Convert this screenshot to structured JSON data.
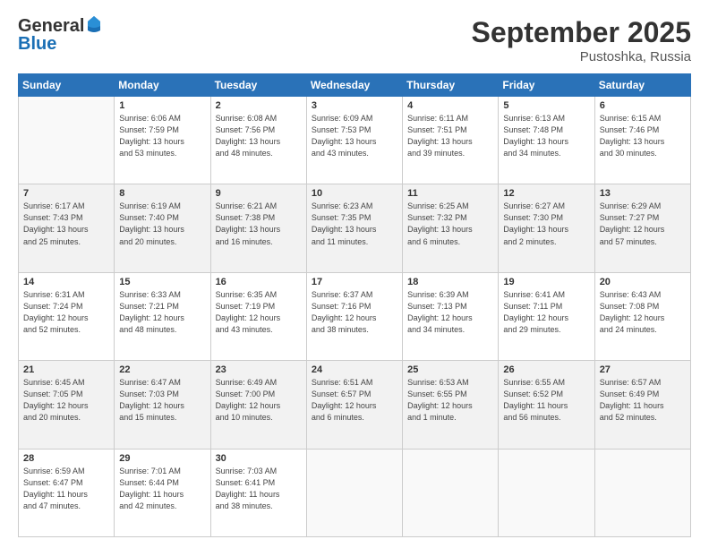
{
  "header": {
    "logo_general": "General",
    "logo_blue": "Blue",
    "month": "September 2025",
    "location": "Pustoshka, Russia"
  },
  "days_of_week": [
    "Sunday",
    "Monday",
    "Tuesday",
    "Wednesday",
    "Thursday",
    "Friday",
    "Saturday"
  ],
  "weeks": [
    [
      {
        "num": "",
        "info": ""
      },
      {
        "num": "1",
        "info": "Sunrise: 6:06 AM\nSunset: 7:59 PM\nDaylight: 13 hours\nand 53 minutes."
      },
      {
        "num": "2",
        "info": "Sunrise: 6:08 AM\nSunset: 7:56 PM\nDaylight: 13 hours\nand 48 minutes."
      },
      {
        "num": "3",
        "info": "Sunrise: 6:09 AM\nSunset: 7:53 PM\nDaylight: 13 hours\nand 43 minutes."
      },
      {
        "num": "4",
        "info": "Sunrise: 6:11 AM\nSunset: 7:51 PM\nDaylight: 13 hours\nand 39 minutes."
      },
      {
        "num": "5",
        "info": "Sunrise: 6:13 AM\nSunset: 7:48 PM\nDaylight: 13 hours\nand 34 minutes."
      },
      {
        "num": "6",
        "info": "Sunrise: 6:15 AM\nSunset: 7:46 PM\nDaylight: 13 hours\nand 30 minutes."
      }
    ],
    [
      {
        "num": "7",
        "info": "Sunrise: 6:17 AM\nSunset: 7:43 PM\nDaylight: 13 hours\nand 25 minutes."
      },
      {
        "num": "8",
        "info": "Sunrise: 6:19 AM\nSunset: 7:40 PM\nDaylight: 13 hours\nand 20 minutes."
      },
      {
        "num": "9",
        "info": "Sunrise: 6:21 AM\nSunset: 7:38 PM\nDaylight: 13 hours\nand 16 minutes."
      },
      {
        "num": "10",
        "info": "Sunrise: 6:23 AM\nSunset: 7:35 PM\nDaylight: 13 hours\nand 11 minutes."
      },
      {
        "num": "11",
        "info": "Sunrise: 6:25 AM\nSunset: 7:32 PM\nDaylight: 13 hours\nand 6 minutes."
      },
      {
        "num": "12",
        "info": "Sunrise: 6:27 AM\nSunset: 7:30 PM\nDaylight: 13 hours\nand 2 minutes."
      },
      {
        "num": "13",
        "info": "Sunrise: 6:29 AM\nSunset: 7:27 PM\nDaylight: 12 hours\nand 57 minutes."
      }
    ],
    [
      {
        "num": "14",
        "info": "Sunrise: 6:31 AM\nSunset: 7:24 PM\nDaylight: 12 hours\nand 52 minutes."
      },
      {
        "num": "15",
        "info": "Sunrise: 6:33 AM\nSunset: 7:21 PM\nDaylight: 12 hours\nand 48 minutes."
      },
      {
        "num": "16",
        "info": "Sunrise: 6:35 AM\nSunset: 7:19 PM\nDaylight: 12 hours\nand 43 minutes."
      },
      {
        "num": "17",
        "info": "Sunrise: 6:37 AM\nSunset: 7:16 PM\nDaylight: 12 hours\nand 38 minutes."
      },
      {
        "num": "18",
        "info": "Sunrise: 6:39 AM\nSunset: 7:13 PM\nDaylight: 12 hours\nand 34 minutes."
      },
      {
        "num": "19",
        "info": "Sunrise: 6:41 AM\nSunset: 7:11 PM\nDaylight: 12 hours\nand 29 minutes."
      },
      {
        "num": "20",
        "info": "Sunrise: 6:43 AM\nSunset: 7:08 PM\nDaylight: 12 hours\nand 24 minutes."
      }
    ],
    [
      {
        "num": "21",
        "info": "Sunrise: 6:45 AM\nSunset: 7:05 PM\nDaylight: 12 hours\nand 20 minutes."
      },
      {
        "num": "22",
        "info": "Sunrise: 6:47 AM\nSunset: 7:03 PM\nDaylight: 12 hours\nand 15 minutes."
      },
      {
        "num": "23",
        "info": "Sunrise: 6:49 AM\nSunset: 7:00 PM\nDaylight: 12 hours\nand 10 minutes."
      },
      {
        "num": "24",
        "info": "Sunrise: 6:51 AM\nSunset: 6:57 PM\nDaylight: 12 hours\nand 6 minutes."
      },
      {
        "num": "25",
        "info": "Sunrise: 6:53 AM\nSunset: 6:55 PM\nDaylight: 12 hours\nand 1 minute."
      },
      {
        "num": "26",
        "info": "Sunrise: 6:55 AM\nSunset: 6:52 PM\nDaylight: 11 hours\nand 56 minutes."
      },
      {
        "num": "27",
        "info": "Sunrise: 6:57 AM\nSunset: 6:49 PM\nDaylight: 11 hours\nand 52 minutes."
      }
    ],
    [
      {
        "num": "28",
        "info": "Sunrise: 6:59 AM\nSunset: 6:47 PM\nDaylight: 11 hours\nand 47 minutes."
      },
      {
        "num": "29",
        "info": "Sunrise: 7:01 AM\nSunset: 6:44 PM\nDaylight: 11 hours\nand 42 minutes."
      },
      {
        "num": "30",
        "info": "Sunrise: 7:03 AM\nSunset: 6:41 PM\nDaylight: 11 hours\nand 38 minutes."
      },
      {
        "num": "",
        "info": ""
      },
      {
        "num": "",
        "info": ""
      },
      {
        "num": "",
        "info": ""
      },
      {
        "num": "",
        "info": ""
      }
    ]
  ]
}
